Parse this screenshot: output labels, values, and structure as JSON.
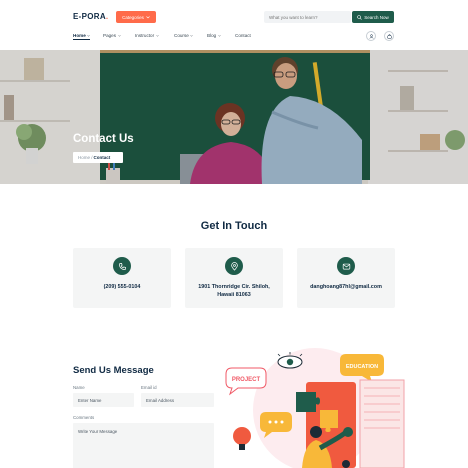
{
  "header": {
    "logo_main": "E-PORA",
    "logo_dot": ".",
    "categories_label": "Categories",
    "search_placeholder": "What you want to learn?",
    "search_button": "Search Now",
    "nav": [
      {
        "label": "Home",
        "active": true
      },
      {
        "label": "Pages"
      },
      {
        "label": "Instructor"
      },
      {
        "label": "Course"
      },
      {
        "label": "Blog"
      },
      {
        "label": "Contact"
      }
    ]
  },
  "hero": {
    "title": "Contact Us",
    "crumb_home": "Home /",
    "crumb_current": "Contact"
  },
  "touch": {
    "title": "Get In Touch",
    "cards": [
      {
        "icon": "phone-icon",
        "lines": [
          "(209) 555-0104"
        ]
      },
      {
        "icon": "location-pin-icon",
        "lines": [
          "1901 Thornridge Cir. Shiloh,",
          "Hawaii 81063"
        ]
      },
      {
        "icon": "mail-icon",
        "lines": [
          "danghoang87hl@gmail.com"
        ]
      }
    ]
  },
  "form": {
    "title": "Send Us Message",
    "name_label": "Name",
    "name_placeholder": "Enter Name",
    "email_label": "Email id",
    "email_placeholder": "Email Address",
    "comments_label": "Comments",
    "comments_placeholder": "Write Your Message"
  },
  "illustration": {
    "project_label": "PROJECT",
    "education_label": "EDUCATION"
  },
  "colors": {
    "accent": "#ff6b4a",
    "primary": "#1f5c4b",
    "heading": "#102a43"
  }
}
